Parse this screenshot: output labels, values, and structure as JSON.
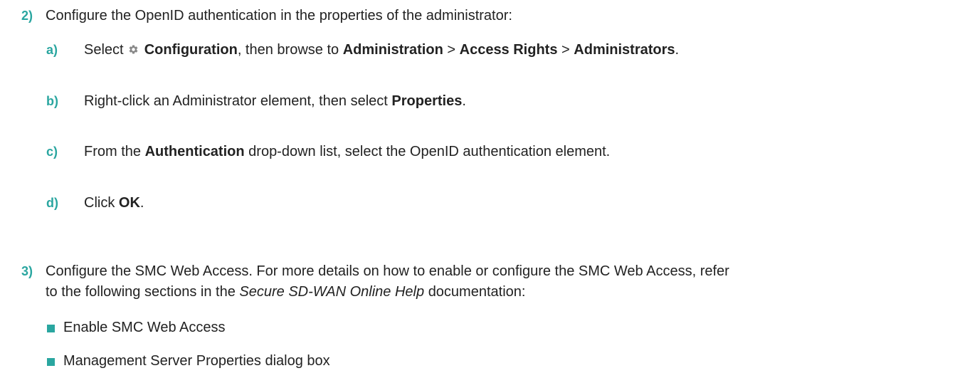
{
  "step2": {
    "number": "2)",
    "text": "Configure the OpenID authentication in the properties of the administrator:",
    "substeps": [
      {
        "letter": "a)",
        "t1": "Select",
        "icon": "gear-icon",
        "b1": "Configuration",
        "t2": ", then browse to",
        "b2": "Administration",
        "sep1": ">",
        "b3": "Access Rights",
        "sep2": ">",
        "b4": "Administrators",
        "t3": "."
      },
      {
        "letter": "b)",
        "t1": "Right-click an Administrator element, then select",
        "b1": "Properties",
        "t2": "."
      },
      {
        "letter": "c)",
        "t1": "From the",
        "b1": "Authentication",
        "t2": "drop-down list, select the OpenID authentication element."
      },
      {
        "letter": "d)",
        "t1": "Click",
        "b1": "OK",
        "t2": "."
      }
    ]
  },
  "step3": {
    "number": "3)",
    "line1": "Configure the SMC Web Access. For more details on how to enable or configure the SMC Web Access, refer",
    "line2_pre": "to the following sections in the",
    "line2_italic": "Secure SD-WAN Online Help",
    "line2_post": "documentation:",
    "bullets": [
      "Enable SMC Web Access",
      "Management Server Properties dialog box"
    ]
  },
  "colors": {
    "accent": "#2aa6a0",
    "text": "#222222"
  }
}
